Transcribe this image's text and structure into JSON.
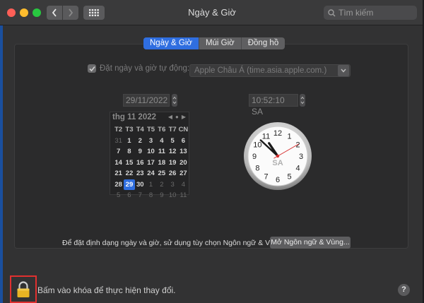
{
  "window": {
    "title": "Ngày & Giờ",
    "search_placeholder": "Tìm kiếm"
  },
  "tabs": [
    {
      "label": "Ngày & Giờ",
      "active": true
    },
    {
      "label": "Múi Giờ",
      "active": false
    },
    {
      "label": "Đồng hồ",
      "active": false
    }
  ],
  "auto_time": {
    "checked": true,
    "label": "Đặt ngày và giờ tự động:",
    "server": "Apple Châu Á (time.asia.apple.com.)"
  },
  "date_field": "29/11/2022",
  "time_field": "10:52:10 SA",
  "calendar": {
    "month_label": "thg 11 2022",
    "weekdays": [
      "T2",
      "T3",
      "T4",
      "T5",
      "T6",
      "T7",
      "CN"
    ],
    "rows": [
      [
        "31",
        "1",
        "2",
        "3",
        "4",
        "5",
        "6"
      ],
      [
        "7",
        "8",
        "9",
        "10",
        "11",
        "12",
        "13"
      ],
      [
        "14",
        "15",
        "16",
        "17",
        "18",
        "19",
        "20"
      ],
      [
        "21",
        "22",
        "23",
        "24",
        "25",
        "26",
        "27"
      ],
      [
        "28",
        "29",
        "30",
        "1",
        "2",
        "3",
        "4"
      ],
      [
        "5",
        "6",
        "7",
        "8",
        "9",
        "10",
        "11"
      ]
    ],
    "selected_day": "29"
  },
  "clock": {
    "hour": 10,
    "minute": 52,
    "second": 10,
    "period_label": "SA",
    "numerals": [
      "12",
      "1",
      "2",
      "3",
      "4",
      "5",
      "6",
      "7",
      "8",
      "9",
      "10",
      "11"
    ]
  },
  "format_note": "Để đặt định dạng ngày và giờ, sử dụng tùy chọn Ngôn ngữ & Vùng.",
  "open_region_button": "Mở Ngôn ngữ & Vùng...",
  "lock_text": "Bấm vào khóa để thực hiện thay đổi.",
  "help_label": "?",
  "colors": {
    "accent": "#2f6ee0",
    "highlight_border": "#e0302f",
    "second_hand": "#d62d2d"
  }
}
